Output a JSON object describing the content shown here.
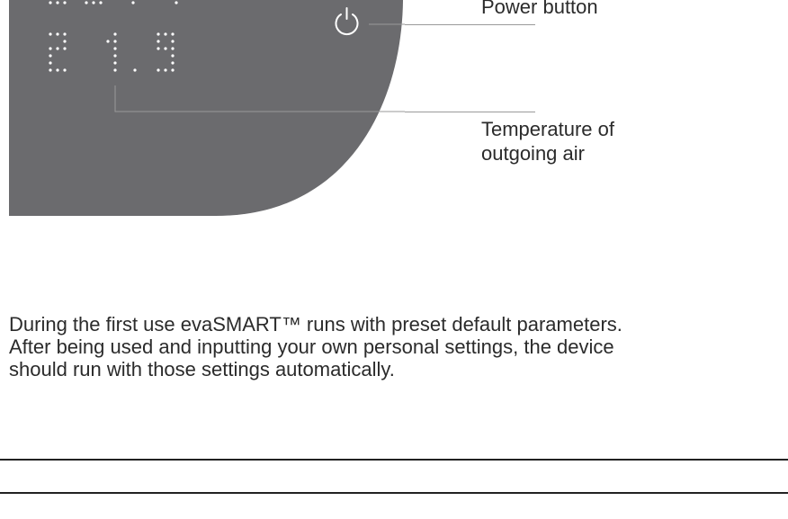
{
  "callouts": {
    "power_button": "Power button",
    "temperature_line1": "Temperature of",
    "temperature_line2": "outgoing air"
  },
  "display": {
    "temperature_reading": "21.9"
  },
  "body": {
    "line1": "During the first use evaSMART™ runs with preset default parameters.",
    "line2": "After being used and inputting your own personal settings, the device",
    "line3": "should run with those settings automatically."
  },
  "colors": {
    "panel": "#6b6b6e",
    "dots": "#ffffff",
    "lines": "#9a9a9a"
  },
  "icons": {
    "power": "power-icon"
  }
}
